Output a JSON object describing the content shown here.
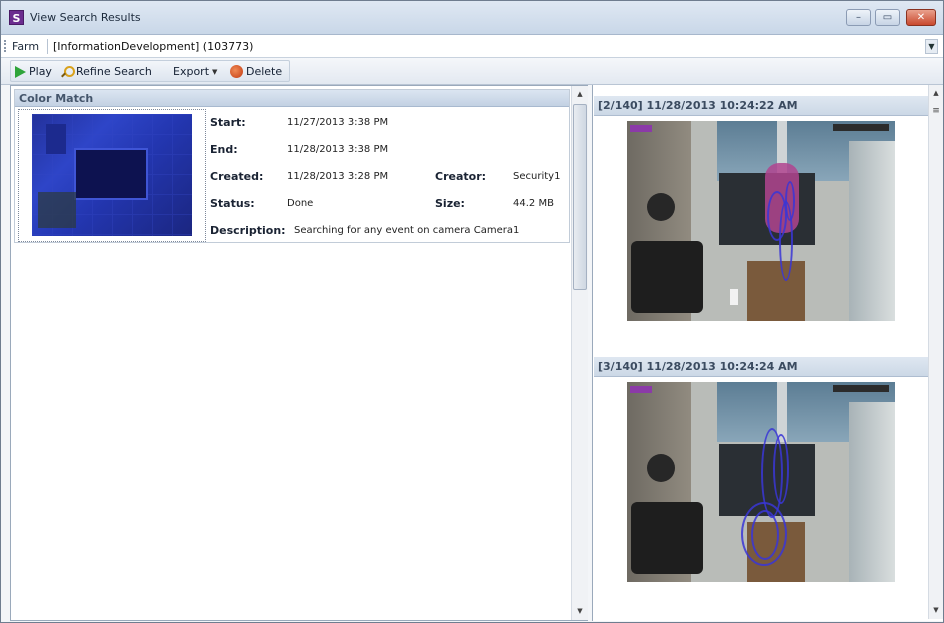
{
  "window": {
    "title": "View Search Results",
    "buttons": {
      "minimize": "–",
      "maximize": "▭",
      "close": "✕"
    }
  },
  "farm_bar": {
    "label": "Farm",
    "value": "[InformationDevelopment] (103773)"
  },
  "toolbar": {
    "play": "Play",
    "refine_search": "Refine Search",
    "export": "Export",
    "delete": "Delete"
  },
  "result": {
    "header": "Color Match",
    "fields": {
      "start_label": "Start:",
      "start_value": "11/27/2013 3:38 PM",
      "end_label": "End:",
      "end_value": "11/28/2013 3:38 PM",
      "created_label": "Created:",
      "created_value": "11/28/2013 3:28 PM",
      "creator_label": "Creator:",
      "creator_value": "Security1",
      "status_label": "Status:",
      "status_value": "Done",
      "size_label": "Size:",
      "size_value": "44.2 MB",
      "description_label": "Description:",
      "description_value": "Searching for any event on camera Camera1"
    }
  },
  "frames": [
    {
      "header": "[2/140] 11/28/2013 10:24:22 AM"
    },
    {
      "header": "[3/140] 11/28/2013 10:24:24 AM"
    }
  ],
  "colors": {
    "header_gradient": "#c3d1e3",
    "trace": "#3a36d6",
    "person": "#b0448f"
  }
}
